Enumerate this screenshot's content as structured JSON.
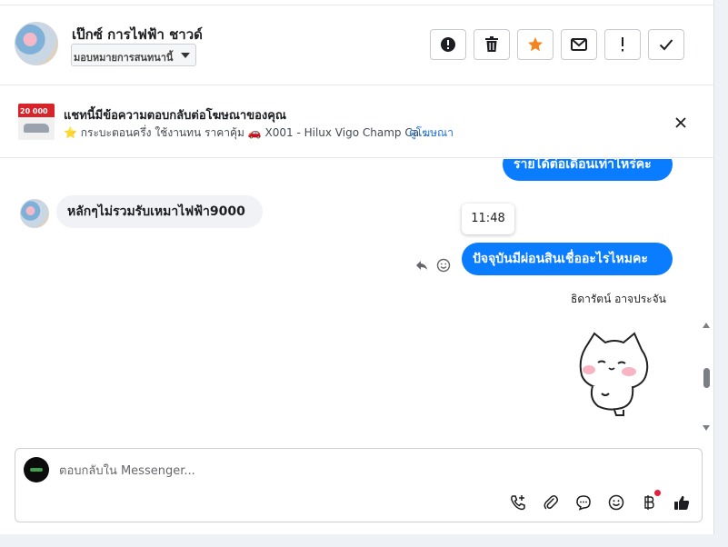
{
  "header": {
    "contact_name": "เป๊กซ์ การไฟฟ้า ชาวด์",
    "assign_label": "มอบหมายการสนทนานี้",
    "actions": [
      {
        "name": "spam",
        "icon": "alert-circle-icon"
      },
      {
        "name": "delete",
        "icon": "trash-icon"
      },
      {
        "name": "star",
        "icon": "star-icon"
      },
      {
        "name": "mark-unread",
        "icon": "envelope-icon"
      },
      {
        "name": "follow-up",
        "icon": "exclamation-icon"
      },
      {
        "name": "done",
        "icon": "checkmark-icon"
      }
    ]
  },
  "ad": {
    "thumb_price": "20 000",
    "title": "แชทนี้มีข้อความตอบกลับต่อโฆษณาของคุณ",
    "subtitle": "⭐ กระบะตอนครึ่ง ใช้งานทน ราคาคุ้ม 🚗 X001 - Hilux Vigo Champ Ca...",
    "view_ad": "ดูโฆษณา"
  },
  "messages": {
    "out_1": "รายได้ต่อเดือนเท่าไหร่คะ",
    "in_1": "หลักๆไม่รวมรับเหมาไฟฟ้า9000",
    "tooltip_time": "11:48",
    "out_2": "ปัจจุบันมีผ่อนสินเชื่ออะไรไหมคะ",
    "sender_name": "ธิดารัตน์ อาจประจัน"
  },
  "composer": {
    "placeholder": "ตอบกลับใน Messenger...",
    "icons": [
      "phone-plus-icon",
      "paperclip-icon",
      "chat-bubble-icon",
      "emoji-icon",
      "baht-icon",
      "thumbs-up-icon"
    ]
  },
  "colors": {
    "accent": "#0a7cff",
    "star": "#f5841f",
    "link": "#216fdb",
    "notification": "#e41e3f"
  }
}
